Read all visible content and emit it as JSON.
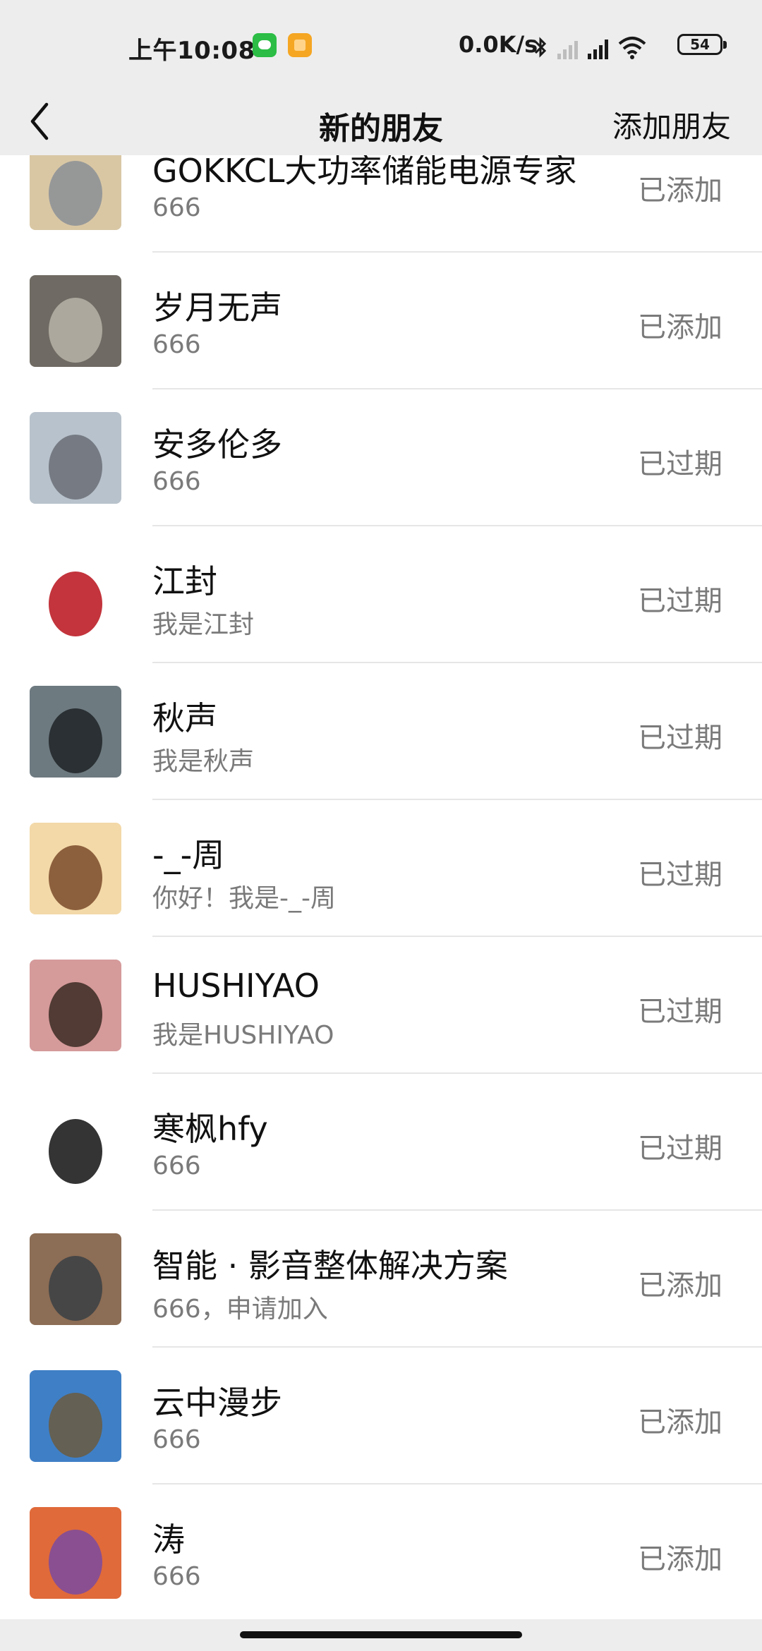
{
  "status_bar": {
    "time": "上午10:08",
    "network_speed": "0.0K/s",
    "battery": "54",
    "app_icons": [
      "wechat-icon",
      "notes-icon"
    ],
    "indicator_icons": [
      "bluetooth-icon",
      "signal-icon",
      "hd-signal-icon",
      "wifi-icon",
      "battery-icon"
    ]
  },
  "nav": {
    "back_icon": "chevron-left-icon",
    "title": "新的朋友",
    "action": "添加朋友"
  },
  "friends": [
    {
      "name": "GOKKCL大功率储能电源专家",
      "message": "666",
      "status": "已添加",
      "avatar_colors": [
        "#d9c7a4",
        "#8a8f96"
      ]
    },
    {
      "name": "岁月无声",
      "message": "666",
      "status": "已添加",
      "avatar_colors": [
        "#6f6a63",
        "#b9b3a8"
      ]
    },
    {
      "name": "安多伦多",
      "message": "666",
      "status": "已过期",
      "avatar_colors": [
        "#b8c2cc",
        "#6a6f75"
      ]
    },
    {
      "name": "江封",
      "message": "我是江封",
      "status": "已过期",
      "avatar_colors": [
        "#ffffff",
        "#b8101a"
      ]
    },
    {
      "name": "秋声",
      "message": "我是秋声",
      "status": "已过期",
      "avatar_colors": [
        "#6d7a80",
        "#1f2326"
      ]
    },
    {
      "name": "-_-周",
      "message": "你好！我是-_-周",
      "status": "已过期",
      "avatar_colors": [
        "#f3d9a8",
        "#7a4a2a"
      ]
    },
    {
      "name": "HUSHIYAO",
      "message": "我是HUSHIYAO",
      "status": "已过期",
      "avatar_colors": [
        "#d59a9a",
        "#3a2a22"
      ]
    },
    {
      "name": "寒枫hfy",
      "message": "666",
      "status": "已过期",
      "avatar_colors": [
        "#ffffff",
        "#111111"
      ]
    },
    {
      "name": "智能 · 影音整体解决方案",
      "message": "666，申请加入",
      "status": "已添加",
      "avatar_colors": [
        "#8c6d55",
        "#3a3f44"
      ]
    },
    {
      "name": "云中漫步",
      "message": "666",
      "status": "已添加",
      "avatar_colors": [
        "#3f7fc6",
        "#6b5a3e"
      ]
    },
    {
      "name": "涛",
      "message": "666",
      "status": "已添加",
      "avatar_colors": [
        "#e06a3a",
        "#7a4aa0"
      ]
    }
  ]
}
